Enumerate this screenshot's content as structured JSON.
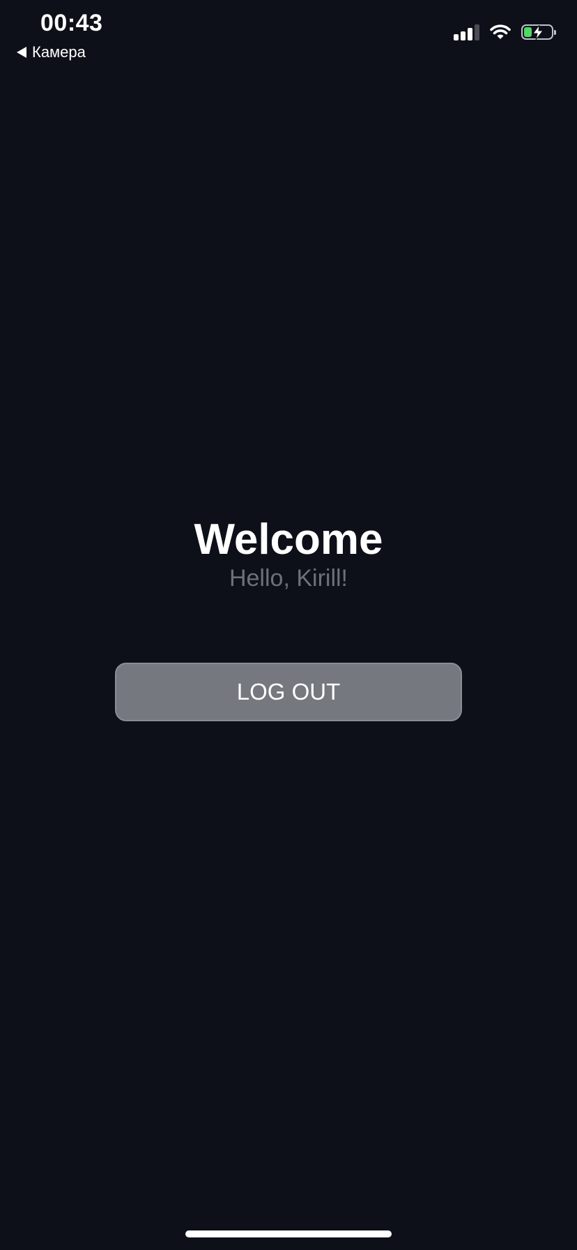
{
  "status_bar": {
    "time": "00:43",
    "back_label": "Камера",
    "signal_icon": "cellular-signal-icon",
    "wifi_icon": "wifi-icon",
    "battery_icon": "battery-charging-icon",
    "battery_color": "#4cd964"
  },
  "main": {
    "title": "Welcome",
    "subtitle": "Hello, Kirill!",
    "logout_label": "LOG OUT"
  },
  "colors": {
    "background": "#0d1018",
    "button": "#75787e",
    "subtitle": "#6d717a"
  }
}
